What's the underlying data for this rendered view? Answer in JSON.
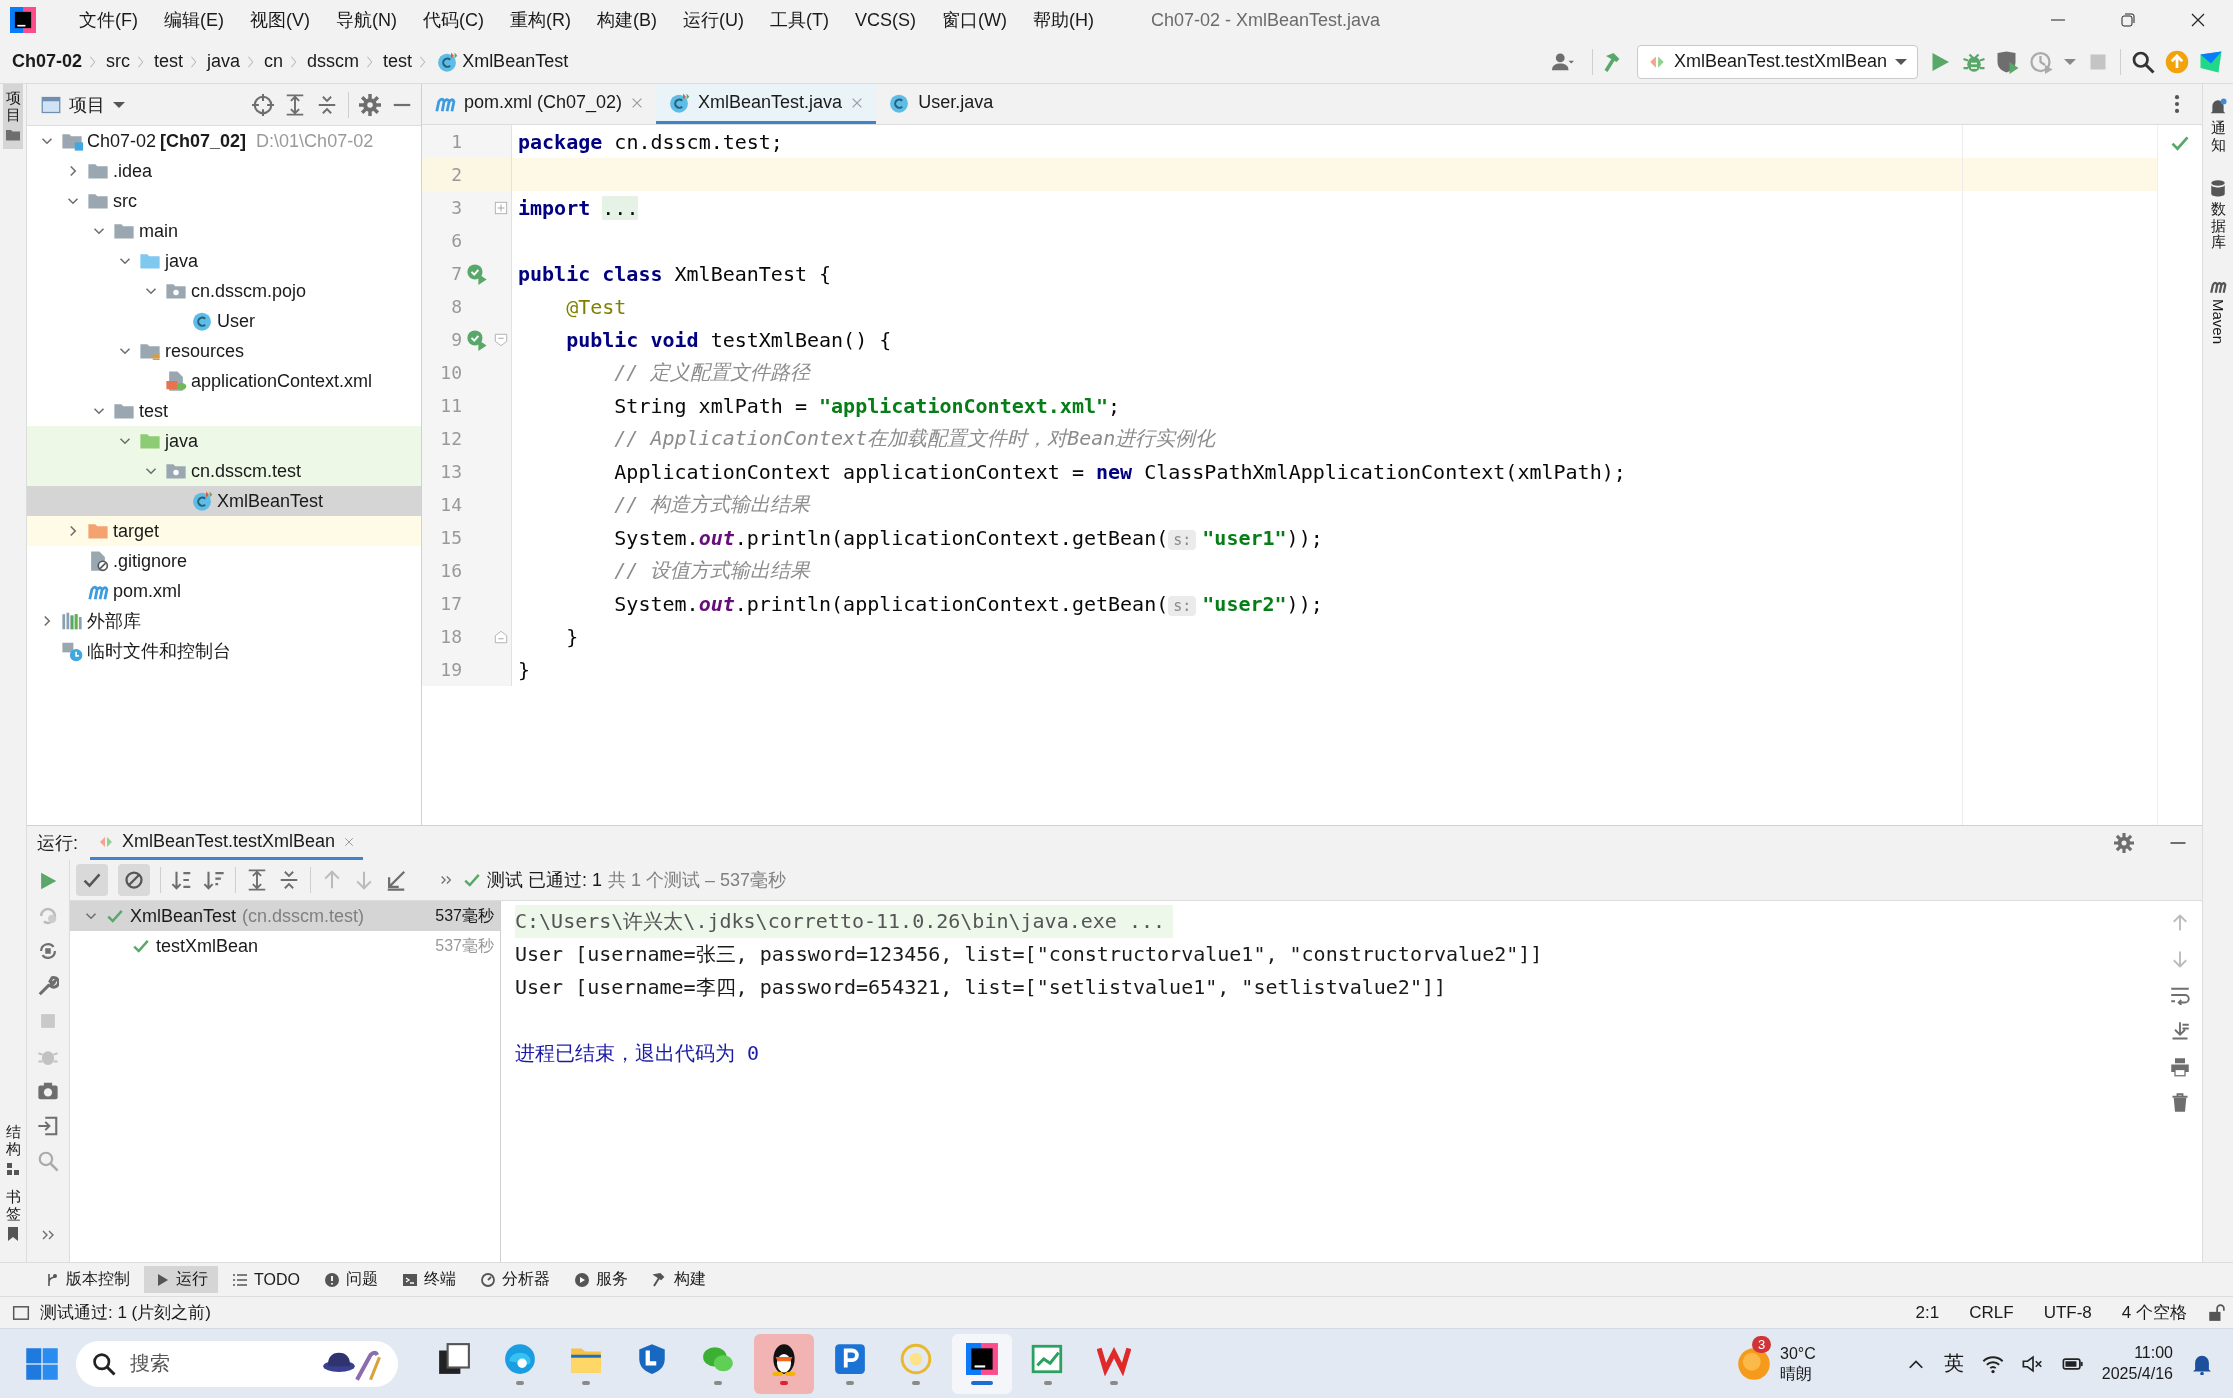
{
  "menu": [
    "文件(F)",
    "编辑(E)",
    "视图(V)",
    "导航(N)",
    "代码(C)",
    "重构(R)",
    "构建(B)",
    "运行(U)",
    "工具(T)",
    "VCS(S)",
    "窗口(W)",
    "帮助(H)"
  ],
  "window_title": "Ch07-02 - XmlBeanTest.java",
  "breadcrumbs": [
    {
      "label": "Ch07-02",
      "kind": "project"
    },
    {
      "label": "src",
      "kind": "folder"
    },
    {
      "label": "test",
      "kind": "folder"
    },
    {
      "label": "java",
      "kind": "folder"
    },
    {
      "label": "cn",
      "kind": "folder"
    },
    {
      "label": "dsscm",
      "kind": "folder"
    },
    {
      "label": "test",
      "kind": "folder"
    },
    {
      "label": "XmlBeanTest",
      "kind": "test-class"
    }
  ],
  "run_config": "XmlBeanTest.testXmlBean",
  "left_strip": {
    "top": [
      {
        "label": "项目",
        "selected": true
      }
    ],
    "bottom": [
      {
        "label": "结构",
        "selected": false
      },
      {
        "label": "书签",
        "selected": false
      }
    ]
  },
  "right_strip": [
    {
      "label": "通知",
      "kind": "bell"
    },
    {
      "label": "数据库",
      "kind": "database"
    },
    {
      "label": "Maven",
      "kind": "arch"
    }
  ],
  "project_panel": {
    "title": "项目"
  },
  "tree": [
    {
      "label": "Ch07-02",
      "tag": "[Ch07_02]",
      "path": "D:\\01\\Ch07-02",
      "kind": "module",
      "expanded": true,
      "selected": false,
      "children": [
        {
          "label": ".idea",
          "kind": "folder",
          "expanded": false,
          "selected": false
        },
        {
          "label": "src",
          "kind": "folder",
          "expanded": true,
          "selected": false,
          "children": [
            {
              "label": "main",
              "kind": "folder",
              "expanded": true,
              "selected": false,
              "children": [
                {
                  "label": "java",
                  "kind": "source",
                  "expanded": true,
                  "selected": false,
                  "children": [
                    {
                      "label": "cn.dsscm.pojo",
                      "kind": "package",
                      "expanded": true,
                      "selected": false,
                      "children": [
                        {
                          "label": "User",
                          "kind": "class",
                          "selected": false
                        }
                      ]
                    }
                  ]
                },
                {
                  "label": "resources",
                  "kind": "resources",
                  "expanded": true,
                  "selected": false,
                  "children": [
                    {
                      "label": "applicationContext.xml",
                      "kind": "spring-xml",
                      "selected": false
                    }
                  ]
                }
              ]
            },
            {
              "label": "test",
              "kind": "folder",
              "expanded": true,
              "selected": false,
              "children": [
                {
                  "label": "java",
                  "kind": "test-source",
                  "test_scope": true,
                  "expanded": true,
                  "selected": false,
                  "children": [
                    {
                      "label": "cn.dsscm.test",
                      "kind": "package",
                      "test_scope": true,
                      "expanded": true,
                      "selected": false,
                      "children": [
                        {
                          "label": "XmlBeanTest",
                          "kind": "test-class",
                          "selected": true
                        }
                      ]
                    }
                  ]
                }
              ]
            }
          ]
        },
        {
          "label": "target",
          "kind": "excluded",
          "excluded": true,
          "expanded": false,
          "selected": false
        },
        {
          "label": ".gitignore",
          "kind": "ignore",
          "selected": false
        },
        {
          "label": "pom.xml",
          "kind": "arch",
          "selected": false
        }
      ]
    },
    {
      "label": "外部库",
      "kind": "library",
      "expanded": false,
      "selected": false
    },
    {
      "label": "临时文件和控制台",
      "kind": "scratch",
      "selected": false
    }
  ],
  "editor_tabs": [
    {
      "label": "pom.xml (Ch07_02)",
      "kind": "arch",
      "selected": false,
      "closable": true
    },
    {
      "label": "XmlBeanTest.java",
      "kind": "test-class",
      "selected": true,
      "closable": true
    },
    {
      "label": "User.java",
      "kind": "class",
      "selected": false,
      "closable": false
    }
  ],
  "code_lines": [
    {
      "number": "1",
      "current": false,
      "tokens": [
        {
          "kind": "keyword",
          "text": "package"
        },
        {
          "kind": "plain",
          "text": " cn.dsscm.test;"
        }
      ]
    },
    {
      "number": "2",
      "current": true
    },
    {
      "number": "3",
      "current": false,
      "folded": true,
      "tokens": [
        {
          "kind": "keyword",
          "text": "import "
        },
        {
          "kind": "folded",
          "text": "..."
        }
      ]
    },
    {
      "number": "6",
      "current": false
    },
    {
      "number": "7",
      "current": false,
      "run_marker": true,
      "tokens": [
        {
          "kind": "keyword",
          "text": "public class"
        },
        {
          "kind": "plain",
          "text": " XmlBeanTest {"
        }
      ]
    },
    {
      "number": "8",
      "current": false,
      "tokens": [
        {
          "kind": "annotation",
          "text": "    @Test"
        }
      ]
    },
    {
      "number": "9",
      "current": false,
      "run_marker": true,
      "fold_start": true,
      "tokens": [
        {
          "kind": "keyword",
          "text": "    public void"
        },
        {
          "kind": "plain",
          "text": " testXmlBean() {"
        }
      ]
    },
    {
      "number": "10",
      "current": false,
      "tokens": [
        {
          "kind": "comment",
          "text": "        // 定义配置文件路径"
        }
      ]
    },
    {
      "number": "11",
      "current": false,
      "tokens": [
        {
          "kind": "plain",
          "text": "        String xmlPath = "
        },
        {
          "kind": "string",
          "text": "\"applicationContext.xml\""
        },
        {
          "kind": "plain",
          "text": ";"
        }
      ]
    },
    {
      "number": "12",
      "current": false,
      "tokens": [
        {
          "kind": "comment",
          "text": "        // ApplicationContext在加载配置文件时，对Bean进行实例化"
        }
      ]
    },
    {
      "number": "13",
      "current": false,
      "tokens": [
        {
          "kind": "plain",
          "text": "        ApplicationContext applicationContext = "
        },
        {
          "kind": "keyword",
          "text": "new"
        },
        {
          "kind": "plain",
          "text": " ClassPathXmlApplicationContext(xmlPath);"
        }
      ]
    },
    {
      "number": "14",
      "current": false,
      "tokens": [
        {
          "kind": "comment",
          "text": "        // 构造方式输出结果"
        }
      ]
    },
    {
      "number": "15",
      "current": false,
      "tokens": [
        {
          "kind": "plain",
          "text": "        System."
        },
        {
          "kind": "field",
          "text": "out"
        },
        {
          "kind": "plain",
          "text": ".println(applicationContext.getBean("
        },
        {
          "kind": "hint",
          "text": "s:"
        },
        {
          "kind": "string",
          "text": "\"user1\""
        },
        {
          "kind": "plain",
          "text": "));"
        }
      ]
    },
    {
      "number": "16",
      "current": false,
      "tokens": [
        {
          "kind": "comment",
          "text": "        // 设值方式输出结果"
        }
      ]
    },
    {
      "number": "17",
      "current": false,
      "tokens": [
        {
          "kind": "plain",
          "text": "        System."
        },
        {
          "kind": "field",
          "text": "out"
        },
        {
          "kind": "plain",
          "text": ".println(applicationContext.getBean("
        },
        {
          "kind": "hint",
          "text": "s:"
        },
        {
          "kind": "string",
          "text": "\"user2\""
        },
        {
          "kind": "plain",
          "text": "));"
        }
      ]
    },
    {
      "number": "18",
      "current": false,
      "fold_end": true,
      "tokens": [
        {
          "kind": "plain",
          "text": "    }"
        }
      ]
    },
    {
      "number": "19",
      "current": false,
      "tokens": [
        {
          "kind": "plain",
          "text": "}"
        }
      ]
    }
  ],
  "run_panel": {
    "label": "运行:",
    "tab": "XmlBeanTest.testXmlBean",
    "toggles": [
      {
        "kind": "check",
        "on": true
      },
      {
        "kind": "ignored",
        "on": true
      }
    ],
    "status": "测试 已通过: 1",
    "status_detail": "共 1 个测试 – 537毫秒",
    "tests": [
      {
        "label": "XmlBeanTest",
        "detail": "(cn.dsscm.test)",
        "time": "537毫秒",
        "selected": true,
        "expanded": true,
        "children": [
          {
            "label": "testXmlBean",
            "time": "537毫秒",
            "selected": false
          }
        ]
      }
    ],
    "console": [
      {
        "kind": "command",
        "text": "C:\\Users\\许兴太\\.jdks\\corretto-11.0.26\\bin\\java.exe ..."
      },
      {
        "kind": "output",
        "text": "User [username=张三, password=123456, list=[\"constructorvalue1\", \"constructorvalue2\"]]"
      },
      {
        "kind": "output",
        "text": "User [username=李四, password=654321, list=[\"setlistvalue1\", \"setlistvalue2\"]]"
      },
      {
        "kind": "blank"
      },
      {
        "kind": "exit",
        "text": "进程已结束，退出代码为 0"
      }
    ]
  },
  "tool_tabs": [
    {
      "label": "版本控制",
      "kind": "branch",
      "selected": false
    },
    {
      "label": "运行",
      "kind": "play",
      "selected": true
    },
    {
      "label": "TODO",
      "kind": "list",
      "selected": false
    },
    {
      "label": "问题",
      "kind": "info",
      "selected": false
    },
    {
      "label": "终端",
      "kind": "terminal",
      "selected": false
    },
    {
      "label": "分析器",
      "kind": "profiler",
      "selected": false
    },
    {
      "label": "服务",
      "kind": "services",
      "selected": false
    },
    {
      "label": "构建",
      "kind": "hammer",
      "selected": false
    }
  ],
  "status_bar": {
    "message": "测试通过: 1 (片刻之前)",
    "items": [
      "2:1",
      "CRLF",
      "UTF-8",
      "4 个空格"
    ]
  },
  "taskbar": {
    "search_placeholder": "搜索",
    "apps": [
      {
        "kind": "task-view",
        "running": false,
        "active": false,
        "attention": false
      },
      {
        "kind": "browser",
        "running": true,
        "active": false,
        "attention": false
      },
      {
        "kind": "folder",
        "running": true,
        "active": false,
        "attention": false
      },
      {
        "kind": "shield",
        "running": false,
        "active": false,
        "attention": false
      },
      {
        "kind": "chat",
        "running": true,
        "active": false,
        "attention": false
      },
      {
        "kind": "penguin",
        "running": true,
        "active": false,
        "attention": true
      },
      {
        "kind": "tile",
        "running": true,
        "active": false,
        "attention": false
      },
      {
        "kind": "flower",
        "running": true,
        "active": false,
        "attention": false
      },
      {
        "kind": "ide",
        "running": true,
        "active": true,
        "attention": false
      },
      {
        "kind": "chart",
        "running": true,
        "active": false,
        "attention": false
      },
      {
        "kind": "zigzag",
        "running": true,
        "active": false,
        "attention": false
      }
    ],
    "weather": {
      "badge": "3",
      "temperature": "30°C",
      "condition": "晴朗"
    },
    "ime": "英",
    "time": "11:00",
    "date": "2025/4/16"
  }
}
